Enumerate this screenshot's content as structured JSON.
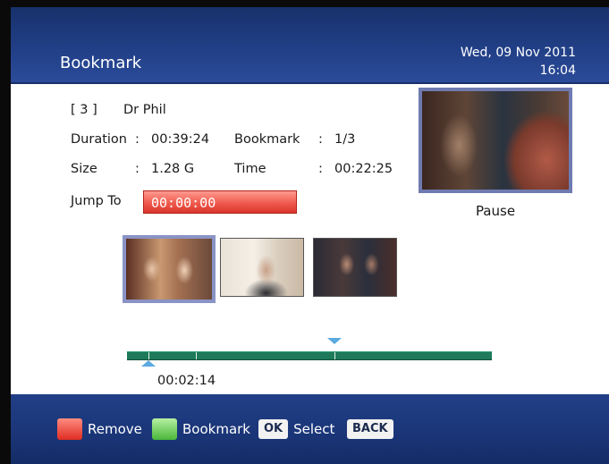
{
  "header": {
    "title": "Bookmark",
    "date": "Wed, 09 Nov 2011",
    "time": "16:04"
  },
  "info": {
    "index": "[ 3 ]",
    "program": "Dr Phil",
    "duration_label": "Duration",
    "duration_value": "00:39:24",
    "bookmark_label": "Bookmark",
    "bookmark_value": "1/3",
    "size_label": "Size",
    "size_value": "1.28 G",
    "time_label": "Time",
    "time_value": "00:22:25",
    "jump_label": "Jump To",
    "jump_value": "00:00:00"
  },
  "preview": {
    "status": "Pause"
  },
  "thumbnails": [
    {
      "name": "bookmark-1",
      "selected": true
    },
    {
      "name": "bookmark-2",
      "selected": false
    },
    {
      "name": "bookmark-3",
      "selected": false
    }
  ],
  "timeline": {
    "position_readout": "00:02:14",
    "current_position_fraction": 0.06,
    "playhead_fraction": 0.57,
    "bookmark_fractions": [
      0.06,
      0.19,
      0.57
    ]
  },
  "footer": {
    "remove_label": "Remove",
    "bookmark_label": "Bookmark",
    "ok_key": "OK",
    "select_label": "Select",
    "back_key": "BACK"
  },
  "colors": {
    "header_blue": "#213f86",
    "jump_field_red": "#f05a4e",
    "timeline_green": "#1e7a5a",
    "marker_blue": "#5aa9e0"
  }
}
